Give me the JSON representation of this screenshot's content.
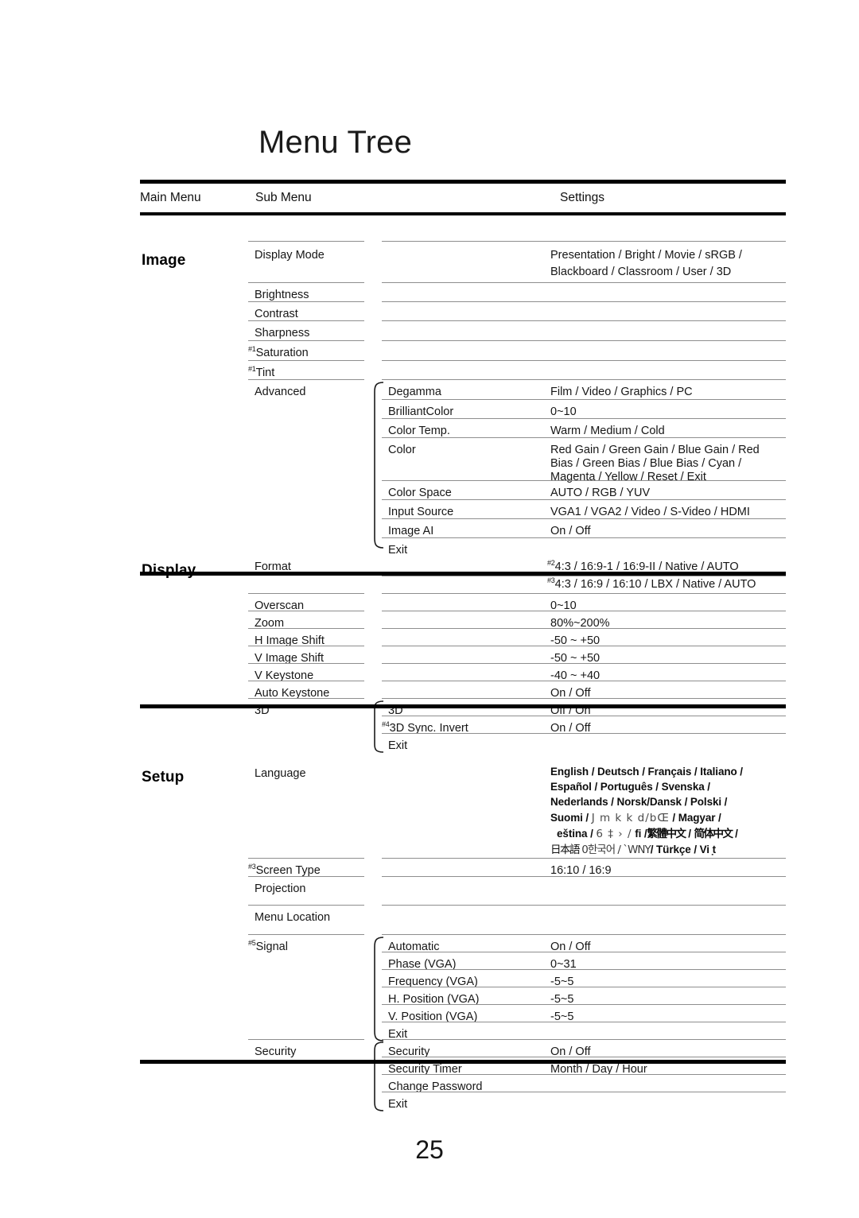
{
  "document": {
    "title": "Menu Tree",
    "page_number": "25"
  },
  "table": {
    "headers": {
      "main_menu": "Main Menu",
      "sub_menu": "Sub Menu",
      "settings": "Settings"
    }
  },
  "sections": {
    "image": {
      "label": "Image",
      "rows": [
        {
          "sub": "Display Mode",
          "settings_line1": "Presentation / Bright / Movie / sRGB /",
          "settings_line2": "Blackboard / Classroom / User / 3D"
        },
        {
          "sub": "Brightness",
          "settings": ""
        },
        {
          "sub": "Contrast",
          "settings": ""
        },
        {
          "sub": "Sharpness",
          "settings": ""
        },
        {
          "sup": "#1",
          "sub": "Saturation",
          "settings": ""
        },
        {
          "sup": "#1",
          "sub": "Tint",
          "settings": ""
        },
        {
          "sub": "Advanced",
          "settings": ""
        }
      ],
      "advanced": [
        {
          "sub2": "Degamma",
          "settings": "Film / Video / Graphics / PC"
        },
        {
          "sub2": "BrilliantColor",
          "settings": "0~10"
        },
        {
          "sub2": "Color Temp.",
          "settings": "Warm / Medium / Cold"
        },
        {
          "sub2": "Color",
          "settings_line1": "Red Gain / Green Gain / Blue Gain / Red",
          "settings_line2": "Bias / Green Bias / Blue Bias / Cyan /",
          "settings_line3": "Magenta / Yellow / Reset / Exit"
        },
        {
          "sub2": "Color Space",
          "settings": "AUTO / RGB / YUV"
        },
        {
          "sub2": "Input Source",
          "settings": "VGA1 / VGA2 / Video / S-Video / HDMI"
        },
        {
          "sub2": "Image AI",
          "settings": "On / Off"
        },
        {
          "sub2": "Exit",
          "settings": ""
        }
      ]
    },
    "display": {
      "label": "Display",
      "rows": [
        {
          "sub": "Format",
          "settings_line1_sup": "#2",
          "settings_line1": "4:3 / 16:9-1 / 16:9-II / Native / AUTO",
          "settings_line2_sup": "#3",
          "settings_line2": "4:3 / 16:9 / 16:10 / LBX / Native / AUTO"
        },
        {
          "sub": "Overscan",
          "settings": "0~10"
        },
        {
          "sub": "Zoom",
          "settings": "80%~200%"
        },
        {
          "sub": "H Image Shift",
          "settings": "-50 ~ +50"
        },
        {
          "sub": "V Image Shift",
          "settings": "-50 ~ +50"
        },
        {
          "sub": "V Keystone",
          "settings": "-40 ~ +40"
        },
        {
          "sub": "Auto Keystone",
          "settings": "On / Off"
        },
        {
          "sub": "3D",
          "settings": ""
        }
      ],
      "threed": [
        {
          "sub2": "3D",
          "settings": "Off / On"
        },
        {
          "sup": "#4",
          "sub2": "3D Sync. Invert",
          "settings": "On / Off"
        },
        {
          "sub2": "Exit",
          "settings": ""
        }
      ]
    },
    "setup": {
      "label": "Setup",
      "language": {
        "sub": "Language",
        "lines": [
          "English / Deutsch / Français / Italiano /",
          "Español / Português / Svenska /",
          "Nederlands / Norsk/Dansk / Polski /"
        ],
        "line4_prefix": "Suomi / ",
        "line4_garbled": "J m k k d/bŒ",
        "line4_suffix": " / Magyar /",
        "line5_prefix": "eština / ",
        "line5_garbled": "6 ‡ › /",
        "line5_mid": "  fi /",
        "line5_cjk1": "繁體中文",
        "line5_sep": " / ",
        "line5_cjk2": "简体中文",
        "line5_suffix": " /",
        "line6_cjk": "日本語",
        "line6_garbled": " 0한국어 / ˋWNY",
        "line6_suffix": "/ Türkçe / Vi ̣t"
      },
      "rows": [
        {
          "sup": "#3",
          "sub": "Screen Type",
          "settings": "16:10 / 16:9"
        },
        {
          "sub": "Projection",
          "settings": ""
        },
        {
          "sub": "Menu Location",
          "settings": ""
        },
        {
          "sup": "#5",
          "sub": "Signal",
          "settings": ""
        }
      ],
      "signal": [
        {
          "sub2": "Automatic",
          "settings": "On / Off"
        },
        {
          "sub2": "Phase (VGA)",
          "settings": "0~31"
        },
        {
          "sub2": "Frequency (VGA)",
          "settings": "-5~5"
        },
        {
          "sub2": "H. Position (VGA)",
          "settings": "-5~5"
        },
        {
          "sub2": "V. Position (VGA)",
          "settings": "-5~5"
        },
        {
          "sub2": "Exit",
          "settings": ""
        }
      ],
      "security_row": {
        "sub": "Security"
      },
      "security": [
        {
          "sub2": "Security",
          "settings": "On / Off"
        },
        {
          "sub2": "Security Timer",
          "settings": "Month / Day / Hour"
        },
        {
          "sub2": "Change Password",
          "settings": ""
        },
        {
          "sub2": "Exit",
          "settings": ""
        }
      ]
    }
  }
}
